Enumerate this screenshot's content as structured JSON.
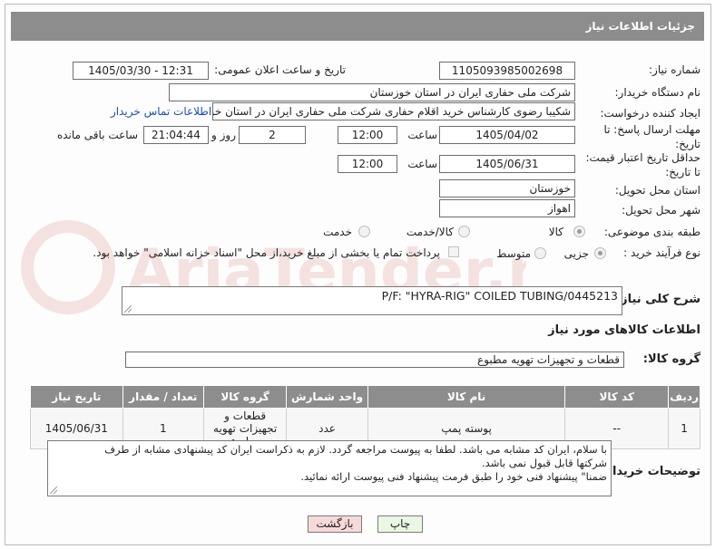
{
  "header": {
    "title": "جزئیات اطلاعات نیاز"
  },
  "need_number": {
    "label": "شماره نیاز:",
    "value": "1105093985002698"
  },
  "announce_datetime": {
    "label": "تاریخ و ساعت اعلان عمومی:",
    "value": "1405/03/30 - 12:31"
  },
  "buyer_org": {
    "label": "نام دستگاه خریدار:",
    "value": "شرکت ملی حفاری ایران در استان خوزستان"
  },
  "requester": {
    "label": "ایجاد کننده درخواست:",
    "value": "شکیبا رضوی کارشناس خرید اقلام حفاری شرکت ملی حفاری ایران در استان خوزستان",
    "contact_link": "اطلاعات تماس خریدار"
  },
  "reply_deadline": {
    "label": "مهلت ارسال پاسخ: تا تاریخ:",
    "date": "1405/04/02",
    "time_label": "ساعت",
    "time": "12:00",
    "days": "2",
    "days_label": "روز و",
    "remaining": "21:04:44",
    "remaining_label": "ساعت باقی مانده"
  },
  "price_validity": {
    "label": "حداقل تاریخ اعتبار قیمت: تا تاریخ:",
    "date": "1405/06/31",
    "time_label": "ساعت",
    "time": "12:00"
  },
  "delivery_province": {
    "label": "استان محل تحویل:",
    "value": "خوزستان"
  },
  "delivery_city": {
    "label": "شهر محل تحویل:",
    "value": "اهواز"
  },
  "category": {
    "label": "طبقه بندی موضوعی:",
    "options": [
      "کالا",
      "کالا/خدمت",
      "خدمت"
    ],
    "selected": "کالا"
  },
  "process_type": {
    "label": "نوع فرآیند خرید :",
    "options": [
      "جزیی",
      "متوسط"
    ],
    "payment_note": "پرداخت تمام یا بخشی از مبلغ خرید،از محل \"اسناد خزانه اسلامی\" خواهد بود."
  },
  "general_desc": {
    "label": "شرح کلی نیاز:",
    "value": "P/F: \"HYRA-RIG\" COILED TUBING/0445213"
  },
  "goods_info": {
    "title": "اطلاعات کالاهای مورد نیاز"
  },
  "goods_group": {
    "label": "گروه کالا:",
    "value": "قطعات و تجهیزات تهویه مطبوع"
  },
  "table": {
    "headers": [
      "ردیف",
      "کد کالا",
      "نام کالا",
      "واحد شمارش",
      "گروه کالا",
      "تعداد / مقدار",
      "تاریخ نیاز"
    ],
    "rows": [
      [
        "1",
        "--",
        "پوسته پمپ",
        "عدد",
        "قطعات و تجهیزات تهویه مطبوع",
        "1",
        "1405/06/31"
      ]
    ]
  },
  "buyer_notes": {
    "label": "توضیحات خریدار:",
    "lines": [
      "با سلام، ایران کد مشابه می باشد. لطفا به پیوست مراجعه گردد. لازم به ذکراست ایران کد پیشنهادی مشابه از طرف",
      "شرکتها قابل قبول نمی باشد.",
      "ضمنا\" پیشنهاد فنی خود را طبق فرمت پیشنهاد فنی پیوست ارائه نمائید."
    ]
  },
  "buttons": {
    "print": "چاپ",
    "back": "بازگشت"
  },
  "colors": {
    "header_bg": "#8d8d8d",
    "link": "#1a4fb4",
    "back_button": "#f7d9d9",
    "print_button": "#e9f7e4"
  },
  "watermark": {
    "text": "AriaTender.neT"
  }
}
